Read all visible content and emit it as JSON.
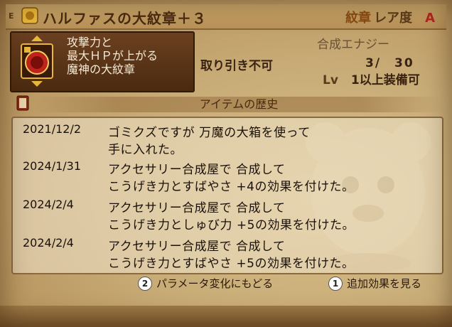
{
  "header": {
    "equip_marker": "E",
    "item_name": "ハルファスの大紋章＋３",
    "category": "紋章",
    "rarity_label": "レア度",
    "rarity_grade": "A"
  },
  "item": {
    "desc_lines": [
      "攻撃力と",
      "最大ＨＰが上がる",
      "魔神の大紋章"
    ],
    "trade_status": "取り引き不可",
    "synthesis_label": "合成エナジー",
    "synthesis_value": "3/　30",
    "level_label": "Lv",
    "level_req": "1以上装備可"
  },
  "history": {
    "title": "アイテムの歴史",
    "entries": [
      {
        "date": "2021/12/2",
        "lines": [
          "ゴミクズですが 万魔の大箱を使って",
          "手に入れた。"
        ]
      },
      {
        "date": "2024/1/31",
        "lines": [
          "アクセサリー合成屋で 合成して",
          "こうげき力とすばやさ +4の効果を付けた。"
        ]
      },
      {
        "date": "2024/2/4",
        "lines": [
          "アクセサリー合成屋で 合成して",
          "こうげき力としゅび力 +5の効果を付けた。"
        ]
      },
      {
        "date": "2024/2/4",
        "lines": [
          "アクセサリー合成屋で 合成して",
          "こうげき力とすばやさ +5の効果を付けた。"
        ]
      }
    ]
  },
  "footer": {
    "btn2_key": "2",
    "btn2_label": "パラメータ変化にもどる",
    "btn1_key": "1",
    "btn1_label": "追加効果を見る"
  },
  "colors": {
    "emblem_red": "#c0231a",
    "frame_gold": "#e8b83a",
    "panel": "#c9ad78"
  }
}
